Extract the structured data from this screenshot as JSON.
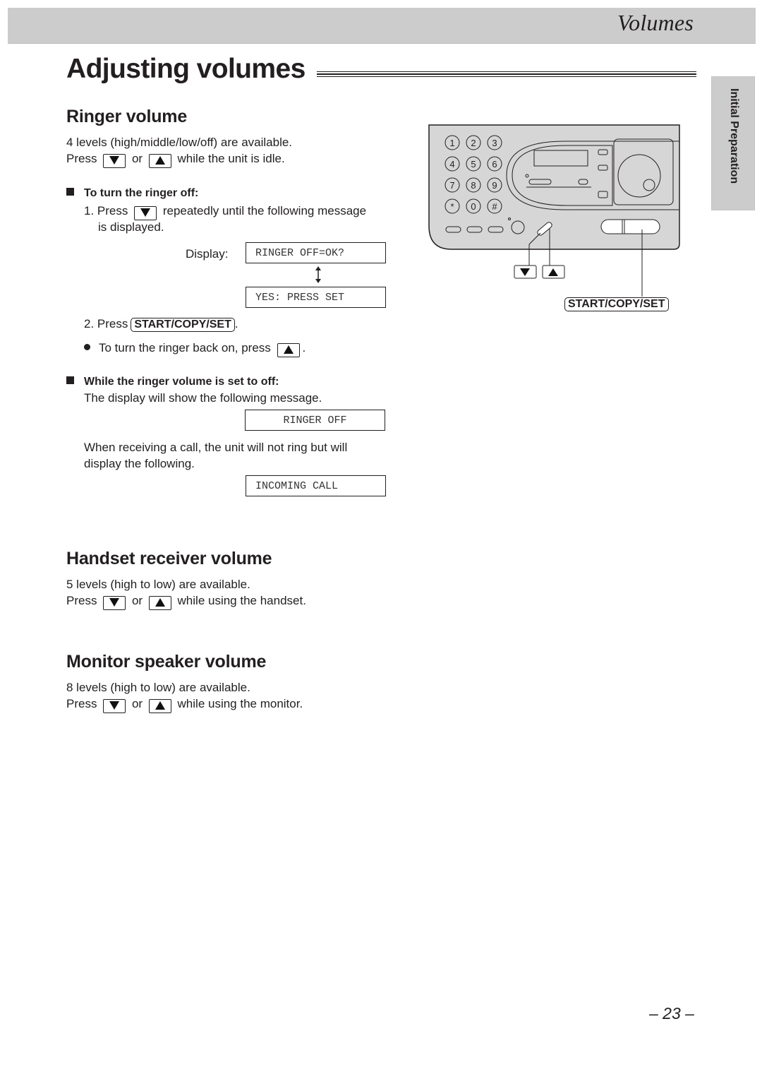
{
  "header": {
    "section_title": "Volumes"
  },
  "side_tab": {
    "label": "Initial Preparation"
  },
  "page_title": "Adjusting volumes",
  "ringer": {
    "heading": "Ringer volume",
    "levels_text": "4 levels (high/middle/low/off) are available.",
    "press": "Press",
    "or": "or",
    "press_suffix": "while the unit is idle.",
    "turn_off": {
      "heading": "To turn the ringer off:",
      "step1_prefix": "1. Press",
      "step1_suffix": "repeatedly until the following message",
      "step1_cont": "is displayed.",
      "display_label": "Display:",
      "display_1": "RINGER OFF=OK?",
      "display_2": "YES: PRESS SET",
      "step2_prefix": "2. Press",
      "step2_button": "START/COPY/SET",
      "step2_suffix": ".",
      "back_on_text": "To turn the ringer back on, press",
      "back_on_suffix": "."
    },
    "while_off": {
      "heading": "While the ringer volume is set to off:",
      "text1": "The display will show the following message.",
      "display_1": "RINGER OFF",
      "text2a": "When receiving a call, the unit will not ring but will",
      "text2b": "display the following.",
      "display_2": "INCOMING CALL"
    }
  },
  "handset": {
    "heading": "Handset receiver volume",
    "levels_text": "5 levels (high to low) are available.",
    "press": "Press",
    "or": "or",
    "press_suffix": "while using the handset."
  },
  "monitor": {
    "heading": "Monitor speaker volume",
    "levels_text": "8 levels (high to low) are available.",
    "press": "Press",
    "or": "or",
    "press_suffix": "while using the monitor."
  },
  "device_diagram": {
    "keypad": [
      "1",
      "2",
      "3",
      "4",
      "5",
      "6",
      "7",
      "8",
      "9",
      "*",
      "0",
      "#"
    ],
    "button_label": "START/COPY/SET"
  },
  "page_number": "– 23 –"
}
